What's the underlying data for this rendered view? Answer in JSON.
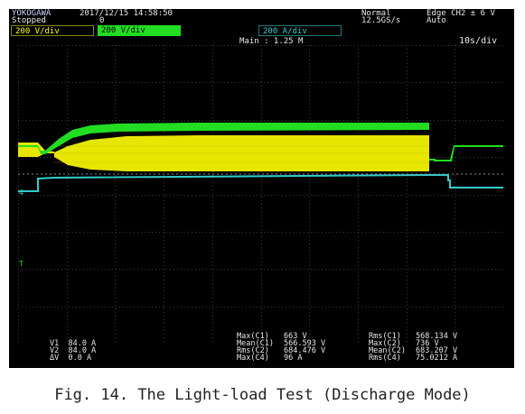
{
  "header": {
    "brand": "YOKOGAWA",
    "datetime": "2017/12/15 14:58:50",
    "status": "Stopped",
    "count": "0",
    "mode": "Normal",
    "sample_rate": "12.5GS/s",
    "trigger": "Edge CH2 ± 6 V",
    "trigger_mode": "Auto"
  },
  "channels": [
    {
      "label": "200 V/div",
      "color": "#ffff00"
    },
    {
      "label": "200 V/div",
      "color": "#33cc33"
    },
    {
      "label": "200 A/div",
      "color": "#33cccc"
    }
  ],
  "main_label": "Main : 1.25 M",
  "timebase": "10s/div",
  "cursors": {
    "v1": "V1  84.0 A",
    "v2": "V2  84.0 A",
    "dv": "ΔV  0.0 A"
  },
  "measurements_left": [
    {
      "name": "Max(C1)",
      "value": "663 V"
    },
    {
      "name": "Mean(C1)",
      "value": "566.593 V"
    },
    {
      "name": "Rms(C2)",
      "value": "684.476 V"
    },
    {
      "name": "Max(C4)",
      "value": "96 A"
    }
  ],
  "measurements_right": [
    {
      "name": "Rms(C1)",
      "value": "568.134 V"
    },
    {
      "name": "Max(C2)",
      "value": "736 V"
    },
    {
      "name": "Mean(C2)",
      "value": "683.207 V"
    },
    {
      "name": "Rms(C4)",
      "value": "75.0212 A"
    }
  ],
  "caption": "Fig. 14. The Light-load Test (Discharge Mode)",
  "colors": {
    "ch1": "#ffff00",
    "ch2": "#22dd22",
    "ch4": "#33cccc",
    "grid": "#3a3a3a"
  }
}
